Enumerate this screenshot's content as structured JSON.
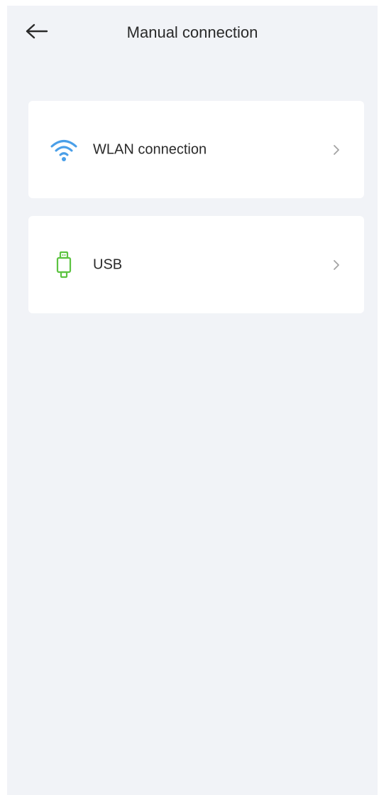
{
  "header": {
    "title": "Manual connection",
    "back_icon": "arrow-left-icon"
  },
  "connections": [
    {
      "label": "WLAN connection",
      "icon": "wifi-icon",
      "icon_color": "#4a9fe8"
    },
    {
      "label": "USB",
      "icon": "usb-icon",
      "icon_color": "#5cc341"
    }
  ],
  "colors": {
    "background": "#f1f3f7",
    "card": "#ffffff",
    "text": "#2a2a2a",
    "chevron": "#a3a3a3"
  }
}
